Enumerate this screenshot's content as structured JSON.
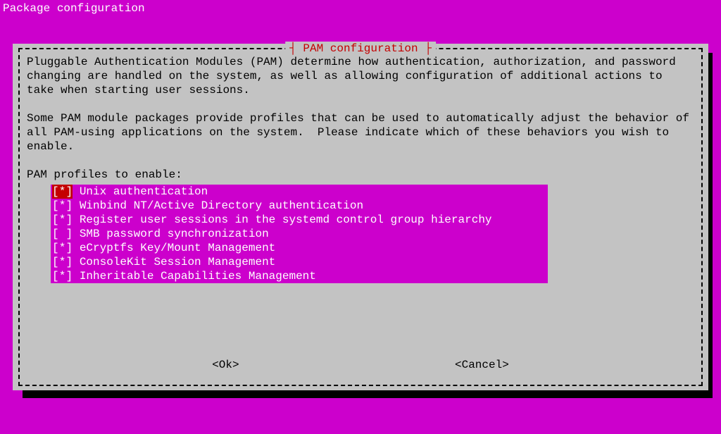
{
  "screen_title": "Package configuration",
  "dialog": {
    "title": "PAM configuration",
    "intro1": "Pluggable Authentication Modules (PAM) determine how authentication, authorization, and password changing are handled on the system, as well as allowing configuration of additional actions to take when starting user sessions.",
    "intro2": "Some PAM module packages provide profiles that can be used to automatically adjust the behavior of all PAM-using applications on the system.  Please indicate which of these behaviors you wish to enable.",
    "prompt": "PAM profiles to enable:",
    "options": [
      {
        "label": "Unix authentication",
        "checked": true,
        "focused": true
      },
      {
        "label": "Winbind NT/Active Directory authentication",
        "checked": true,
        "focused": false
      },
      {
        "label": "Register user sessions in the systemd control group hierarchy",
        "checked": true,
        "focused": false
      },
      {
        "label": "SMB password synchronization",
        "checked": false,
        "focused": false
      },
      {
        "label": "eCryptfs Key/Mount Management",
        "checked": true,
        "focused": false
      },
      {
        "label": "ConsoleKit Session Management",
        "checked": true,
        "focused": false
      },
      {
        "label": "Inheritable Capabilities Management",
        "checked": true,
        "focused": false
      }
    ],
    "buttons": {
      "ok": "<Ok>",
      "cancel": "<Cancel>"
    }
  }
}
